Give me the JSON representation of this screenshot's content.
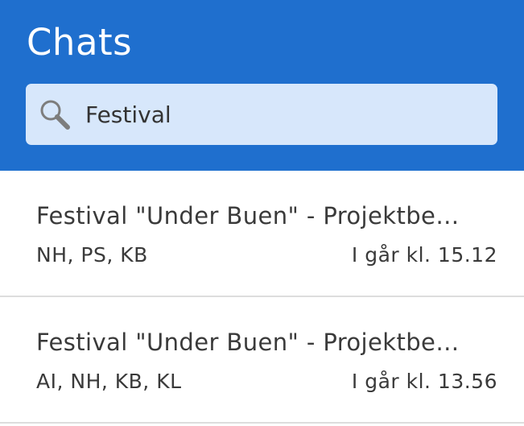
{
  "header": {
    "title": "Chats",
    "background_color": "#1f6fce"
  },
  "search": {
    "icon": "search-icon",
    "value": "Festival",
    "background_color": "#d7e7fb"
  },
  "chats": [
    {
      "title": "Festival \"Under Buen\" - Projektbe…",
      "participants": "NH, PS, KB",
      "time": "I går kl. 15.12"
    },
    {
      "title": "Festival \"Under Buen\" - Projektbe…",
      "participants": "AI, NH, KB, KL",
      "time": "I går kl. 13.56"
    }
  ]
}
